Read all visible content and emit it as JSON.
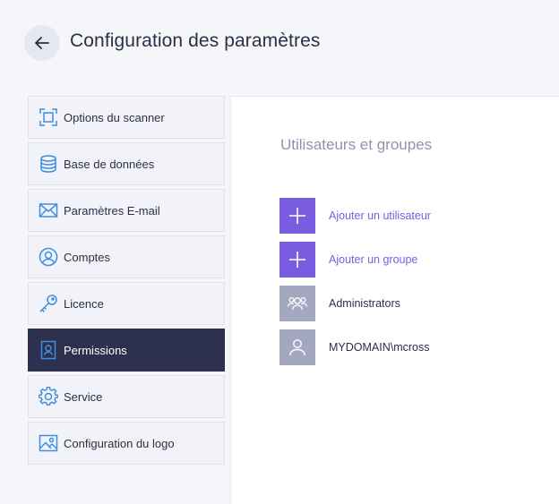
{
  "header": {
    "title": "Configuration des paramètres",
    "back_icon": "arrow-left-icon"
  },
  "sidebar": {
    "items": [
      {
        "label": "Options du scanner",
        "icon": "scan-frame-icon",
        "active": false
      },
      {
        "label": "Base de données",
        "icon": "database-icon",
        "active": false
      },
      {
        "label": "Paramètres E-mail",
        "icon": "envelope-icon",
        "active": false
      },
      {
        "label": "Comptes",
        "icon": "user-circle-icon",
        "active": false
      },
      {
        "label": "Licence",
        "icon": "key-icon",
        "active": false
      },
      {
        "label": "Permissions",
        "icon": "badge-icon",
        "active": true
      },
      {
        "label": "Service",
        "icon": "gear-icon",
        "active": false
      },
      {
        "label": "Configuration du logo",
        "icon": "image-icon",
        "active": false
      }
    ]
  },
  "main": {
    "section_title": "Utilisateurs et groupes",
    "actions": [
      {
        "label": "Ajouter un utilisateur",
        "icon": "plus-icon"
      },
      {
        "label": "Ajouter un groupe",
        "icon": "plus-icon"
      }
    ],
    "entries": [
      {
        "label": "Administrators",
        "icon": "group-icon"
      },
      {
        "label": "MYDOMAIN\\mcross",
        "icon": "user-icon"
      }
    ]
  },
  "colors": {
    "accent": "#7a5ce0",
    "sidebar_active": "#2e3050",
    "icon_blue": "#3d8ee0",
    "entry_tile": "#a3a7bf"
  }
}
